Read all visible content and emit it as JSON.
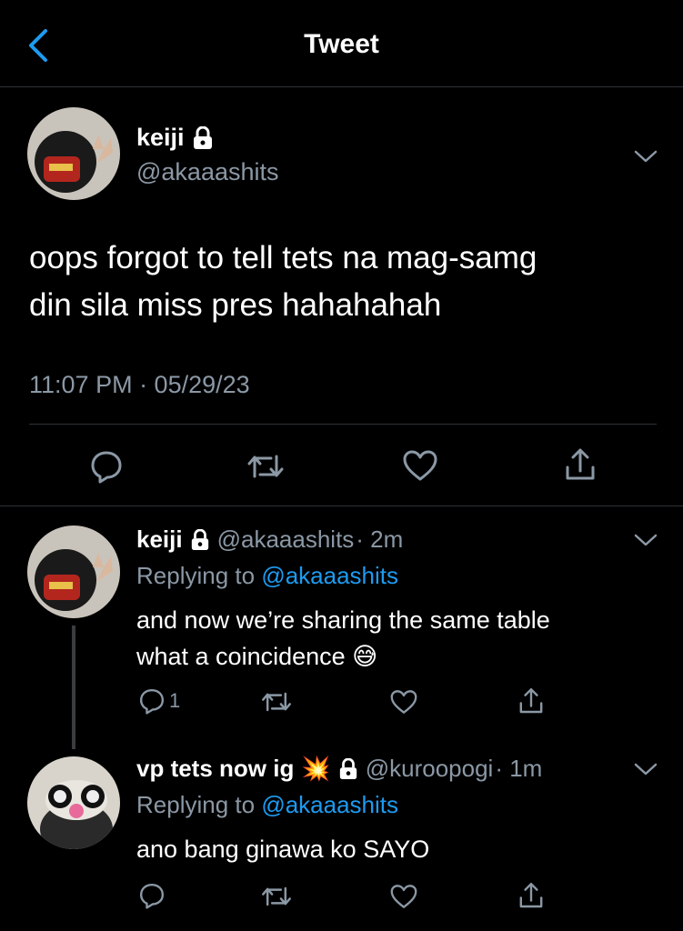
{
  "header": {
    "title": "Tweet",
    "back_icon": "chevron-left-icon"
  },
  "main_tweet": {
    "name": "keiji",
    "handle": "@akaaashits",
    "text_line1": "oops forgot to tell tets na mag-samg",
    "text_line2": "din sila miss pres hahahahah",
    "timestamp": "11:07 PM · 05/29/23"
  },
  "replies": [
    {
      "name": "keiji",
      "handle": "@akaaashits",
      "time": "· 2m",
      "replying_prefix": "Replying to",
      "replying_to": "@akaaashits",
      "text_line1": "and now we’re sharing the same table",
      "text_line2": "what a coincidence",
      "emoji": "😅",
      "reply_count": "1"
    },
    {
      "name": "vp tets now ig",
      "name_emoji": "💥",
      "handle": "@kuroopogi",
      "time": "· 1m",
      "replying_prefix": "Replying to",
      "replying_to": "@akaaashits",
      "text_line1": "ano bang ginawa ko SAYO",
      "reply_count": ""
    }
  ],
  "colors": {
    "background": "#000000",
    "text": "#e7e9ea",
    "muted": "#8b98a5",
    "link": "#1d9bf0",
    "divider": "#2f3336"
  }
}
